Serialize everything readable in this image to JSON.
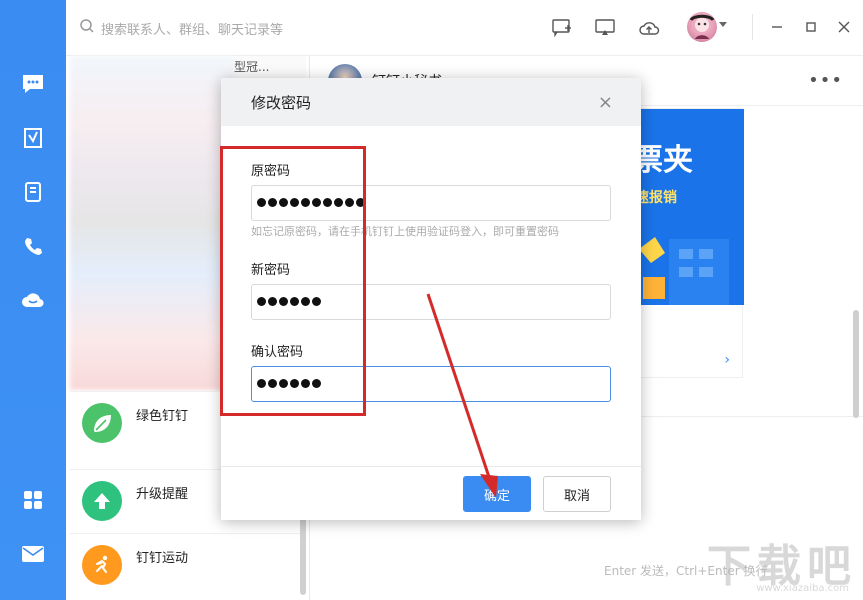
{
  "search": {
    "placeholder": "搜索联系人、群组、聊天记录等"
  },
  "rail": {
    "items": [
      "chat-icon",
      "ding-icon",
      "contacts-icon",
      "phone-icon",
      "cloud-icon",
      "apps-icon",
      "mail-icon"
    ]
  },
  "conversations": {
    "partial_text": "型冠...",
    "items": [
      {
        "name": "绿色钉钉",
        "icon": "leaf-icon",
        "color": "#4cc36a"
      },
      {
        "name": "升级提醒",
        "icon": "upgrade-arrow-icon",
        "color": "#2ec27e"
      },
      {
        "name": "钉钉运动",
        "icon": "runner-icon",
        "color": "#ff9a1f"
      }
    ]
  },
  "chat": {
    "title": "钉钉小秘书",
    "banner_line1": "票夹",
    "banner_line2": "速报销",
    "card_link": "›",
    "hint": "Enter 发送，Ctrl+Enter 换行"
  },
  "dialog": {
    "title": "修改密码",
    "close": "×",
    "old_label": "原密码",
    "old_hint": "如忘记原密码，请在手机钉钉上使用验证码登入，即可重置密码",
    "new_label": "新密码",
    "confirm_label": "确认密码",
    "ok": "确定",
    "cancel": "取消"
  },
  "watermark": {
    "big": "下载吧",
    "small": "www.xiazaiba.com"
  },
  "colors": {
    "primary": "#3b8cf2",
    "annotation": "#d42a2a"
  }
}
